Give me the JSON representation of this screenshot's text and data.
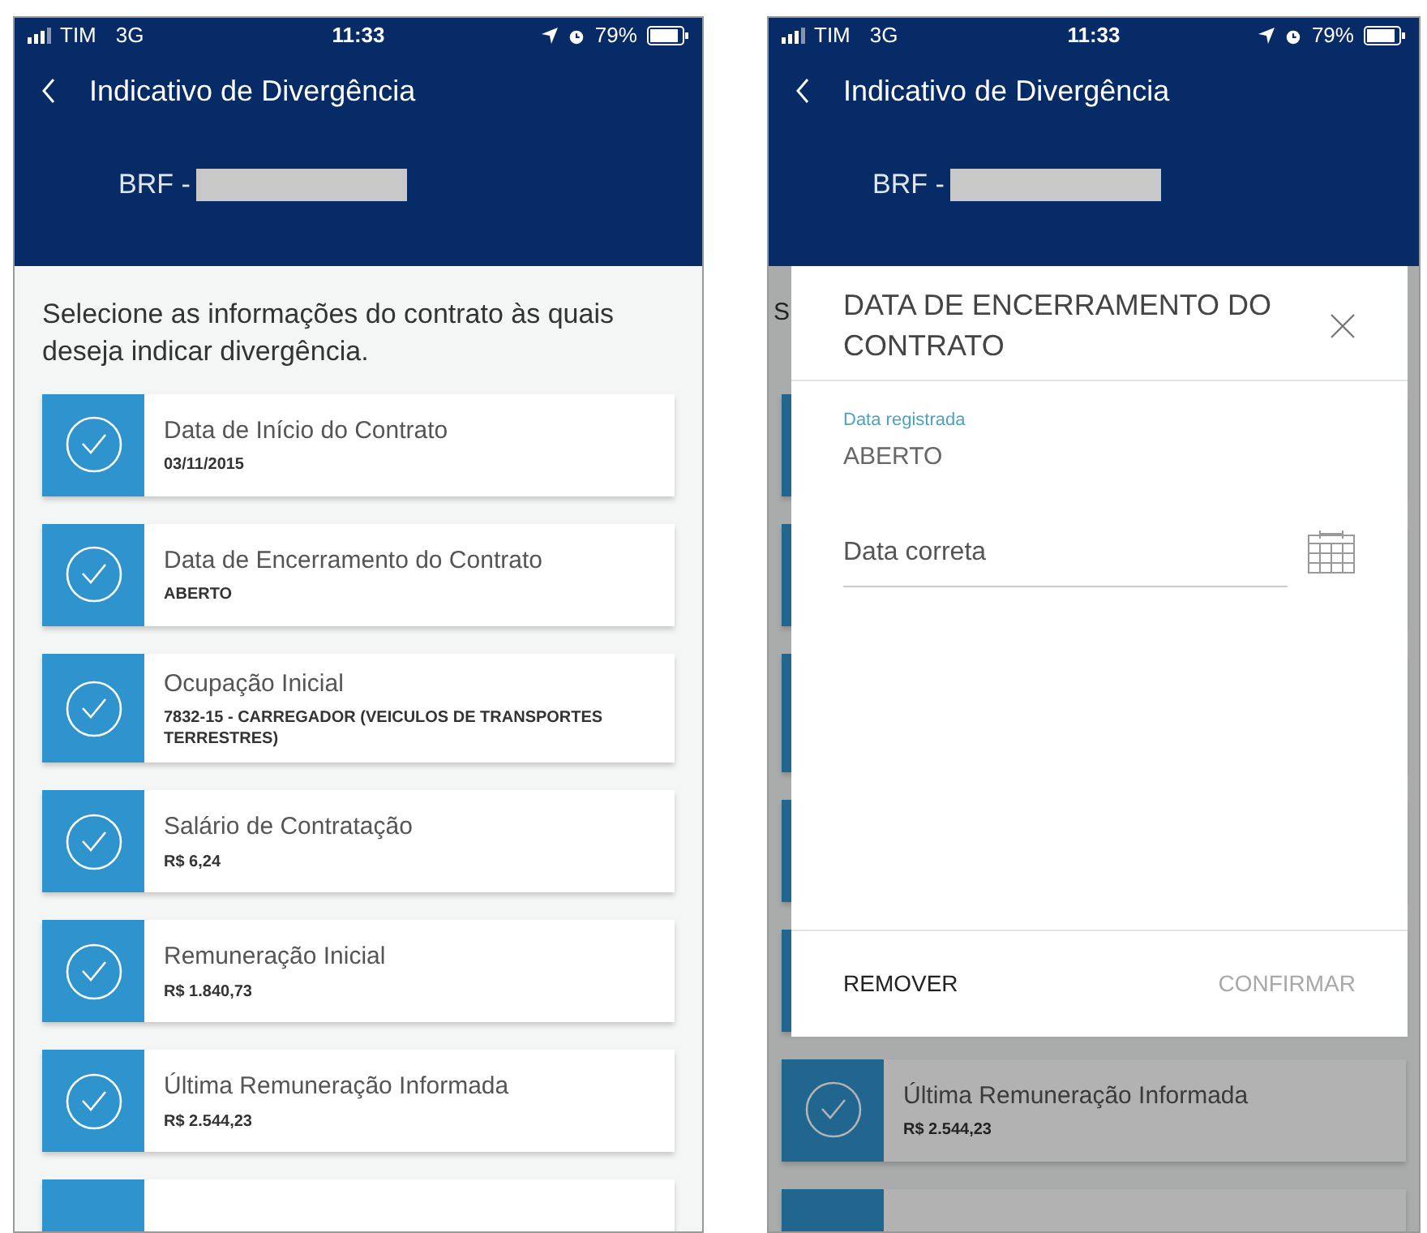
{
  "phones": [
    {
      "status_bar": {
        "carrier": "TIM",
        "network": "3G",
        "time": "11:33",
        "battery": "79%"
      },
      "header": {
        "title": "Indicativo de Divergência",
        "company": "BRF -"
      },
      "intro": "Selecione as informações do contrato às quais deseja indicar divergência.",
      "items": [
        {
          "title": "Data de Início do Contrato",
          "value": "03/11/2015"
        },
        {
          "title": "Data de Encerramento do Contrato",
          "value": "ABERTO"
        },
        {
          "title": "Ocupação Inicial",
          "value": "7832-15 - CARREGADOR (VEICULOS DE TRANSPORTES TERRESTRES)"
        },
        {
          "title": "Salário de Contratação",
          "value": "R$ 6,24"
        },
        {
          "title": "Remuneração Inicial",
          "value": "R$ 1.840,73"
        },
        {
          "title": "Última Remuneração Informada",
          "value": "R$ 2.544,23"
        }
      ]
    },
    {
      "status_bar": {
        "carrier": "TIM",
        "network": "3G",
        "time": "11:33",
        "battery": "79%"
      },
      "header": {
        "title": "Indicativo de Divergência",
        "company": "BRF -"
      },
      "intro": "S",
      "items": [
        {
          "title": "Última Remuneração Informada",
          "value": "R$ 2.544,23"
        }
      ],
      "modal": {
        "title": "DATA DE ENCERRAMENTO DO CONTRATO",
        "registered_label": "Data registrada",
        "registered_value": "ABERTO",
        "field": {
          "placeholder": "Data correta"
        },
        "buttons": [
          {
            "label": "REMOVER",
            "disabled": false
          },
          {
            "label": "CONFIRMAR",
            "disabled": true
          }
        ]
      }
    }
  ]
}
